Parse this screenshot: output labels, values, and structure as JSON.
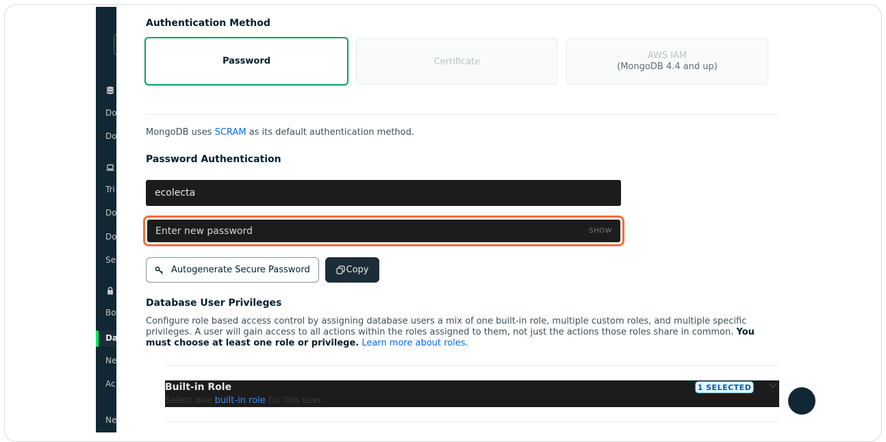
{
  "auth": {
    "title": "Authentication Method",
    "options": [
      {
        "label": "Password",
        "sub": ""
      },
      {
        "label": "Certificate",
        "sub": ""
      },
      {
        "label": "AWS IAM",
        "sub": "(MongoDB 4.4 and up)"
      }
    ]
  },
  "scram_desc": {
    "before": "MongoDB uses ",
    "link": "SCRAM",
    "after": " as its default authentication method."
  },
  "password_auth": {
    "title": "Password Authentication",
    "username_value": "ecolecta",
    "password_placeholder": "Enter new password",
    "show_label": "SHOW",
    "autogen_label": "Autogenerate Secure Password",
    "copy_label": "Copy"
  },
  "privileges": {
    "title": "Database User Privileges",
    "text_main": "Configure role based access control by assigning database users a mix of one built-in role, multiple custom roles, and multiple specific privileges. A user will gain access to all actions within the roles assigned to them, not just the actions those roles share in common. ",
    "text_bold": "You must choose at least one role or privilege.",
    "link": "Learn more about roles."
  },
  "builtin_role": {
    "title": "Built-in Role",
    "sub_before": "Select one ",
    "sub_link": "built-in role",
    "sub_after": " for this user.",
    "badge": "1 SELECTED"
  },
  "sidebar": {
    "items": [
      "Do",
      "Do",
      "Tri",
      "Do",
      "Do",
      "Se",
      "Bo",
      "Da",
      "Ne",
      "Ac",
      "Ne"
    ]
  },
  "colors": {
    "accent_green": "#00a35c",
    "focus_orange": "#f26e3a",
    "link_blue": "#016bf8",
    "sidebar_bg": "#112733"
  }
}
